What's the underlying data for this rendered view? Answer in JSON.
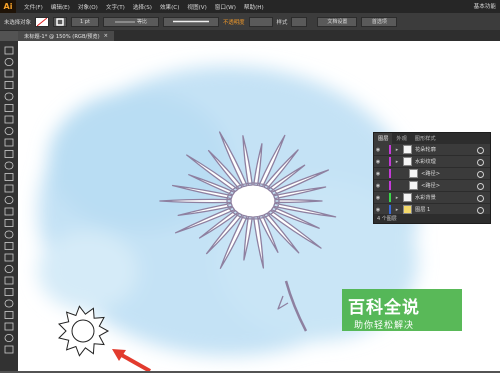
{
  "app": {
    "logo": "Ai"
  },
  "menu": {
    "items": [
      "文件(F)",
      "编辑(E)",
      "对象(O)",
      "文字(T)",
      "选择(S)",
      "效果(C)",
      "视图(V)",
      "窗口(W)",
      "帮助(H)"
    ],
    "workspace": "基本功能"
  },
  "control_bar": {
    "selection_status": "未选择对象",
    "stroke_weight": "1 pt",
    "stroke_profile": "等比",
    "opacity_label": "不透明度",
    "style_label": "样式",
    "doc_setup": "文档设置",
    "preferences": "首选项"
  },
  "document": {
    "tab_title": "未标题-1* @ 150% (RGB/预览)",
    "close_glyph": "×"
  },
  "layers_panel": {
    "tabs": [
      "图层",
      "外观",
      "图形样式"
    ],
    "rows": [
      {
        "name": "花朵轮廓",
        "indent": 0,
        "color": "#c43ad8"
      },
      {
        "name": "水彩纹理",
        "indent": 0,
        "color": "#c43ad8"
      },
      {
        "name": "<路径>",
        "indent": 1,
        "color": "#c43ad8"
      },
      {
        "name": "<路径>",
        "indent": 1,
        "color": "#c43ad8"
      },
      {
        "name": "水彩背景",
        "indent": 0,
        "color": "#3ad84a"
      },
      {
        "name": "图层 1",
        "indent": 0,
        "color": "#3a6ad8"
      }
    ],
    "footer": "4 个图层"
  },
  "watermark": {
    "title": "百科全说",
    "subtitle": "助你轻松解决"
  },
  "icons": [
    "selection-tool-icon",
    "direct-select-icon",
    "magic-wand-icon",
    "lasso-icon",
    "pen-icon",
    "type-icon",
    "line-icon",
    "rect-icon",
    "brush-icon",
    "pencil-icon",
    "eraser-icon",
    "rotate-icon",
    "scale-icon",
    "width-icon",
    "free-transform-icon",
    "shape-builder-icon",
    "perspective-icon",
    "mesh-icon",
    "gradient-icon",
    "eyedropper-icon",
    "blend-icon",
    "symbol-sprayer-icon",
    "graph-icon",
    "artboard-icon",
    "slice-icon",
    "hand-icon",
    "zoom-icon"
  ],
  "colors": {
    "accent": "#f29a2a",
    "watermark_green": "#4bb34a",
    "arrow_red": "#e23b2e"
  }
}
